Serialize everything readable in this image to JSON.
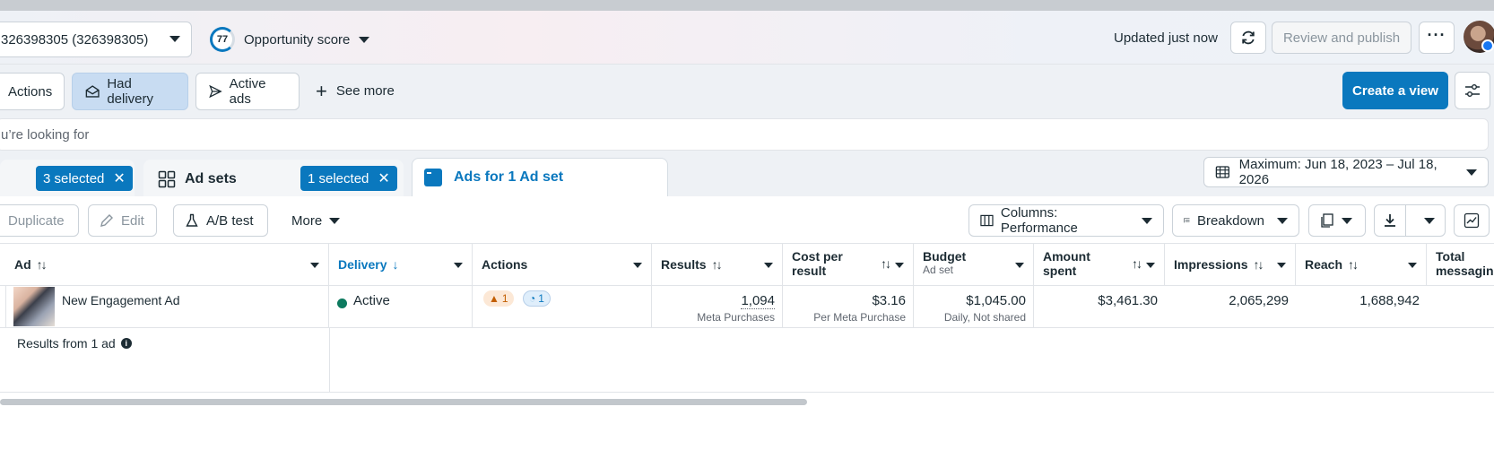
{
  "header": {
    "account_label": "326398305 (326398305)",
    "score_value": "77",
    "score_label": "Opportunity score",
    "updated_text": "Updated just now",
    "review_label": "Review and publish"
  },
  "filters": {
    "chips": [
      "Actions",
      "Had delivery",
      "Active ads"
    ],
    "see_more": "See more",
    "create_view": "Create a view",
    "search_placeholder": "u’re looking for"
  },
  "tabs": {
    "campaigns_selected": "3 selected",
    "adsets_label": "Ad sets",
    "adsets_selected": "1 selected",
    "ads_label": "Ads for 1 Ad set",
    "date_range": "Maximum: Jun 18, 2023 – Jul 18, 2026"
  },
  "toolbar": {
    "duplicate": "Duplicate",
    "edit": "Edit",
    "ab_test": "A/B test",
    "more": "More",
    "columns": "Columns: Performance",
    "breakdown": "Breakdown"
  },
  "table": {
    "headers": {
      "ad": "Ad",
      "delivery": "Delivery",
      "actions": "Actions",
      "results": "Results",
      "cost_line1": "Cost per",
      "cost_line2": "result",
      "budget": "Budget",
      "budget_sub": "Ad set",
      "amount_line1": "Amount",
      "amount_line2": "spent",
      "impressions": "Impressions",
      "reach": "Reach",
      "total_line1": "Total",
      "total_line2": "messaging"
    },
    "row": {
      "ad_name": "New Engagement Ad",
      "delivery": "Active",
      "warn_count": "1",
      "info_count": "1",
      "results": "1,094",
      "results_sub": "Meta Purchases",
      "cost": "$3.16",
      "cost_sub": "Per Meta Purchase",
      "budget": "$1,045.00",
      "budget_sub": "Daily, Not shared",
      "amount": "$3,461.30",
      "impressions": "2,065,299",
      "reach": "1,688,942"
    },
    "footer_text": "Results from 1 ad"
  },
  "colors": {
    "primary": "#0a78be",
    "active_dot": "#0d7a5f",
    "warning": "#c25e00"
  }
}
